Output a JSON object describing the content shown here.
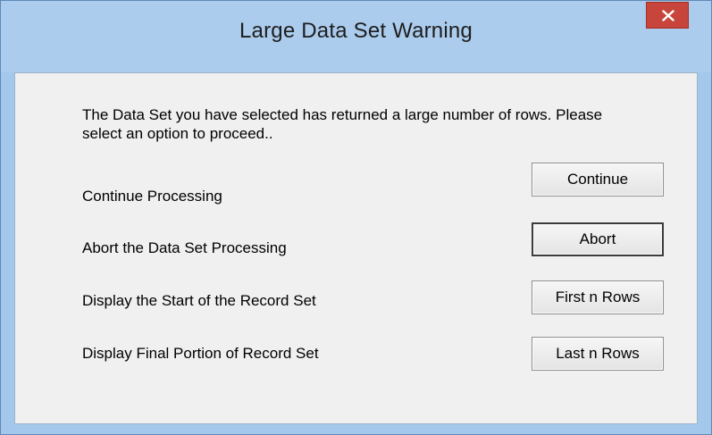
{
  "window": {
    "title": "Large Data Set Warning",
    "close_icon": "close-icon"
  },
  "dialog": {
    "message": "The Data Set you have selected has returned a large number of rows. Please select an option to proceed..",
    "options": [
      {
        "label": "Continue Processing",
        "button": "Continue"
      },
      {
        "label": "Abort the Data Set Processing",
        "button": "Abort"
      },
      {
        "label": "Display the Start of the Record Set",
        "button": "First n Rows"
      },
      {
        "label": "Display Final Portion of Record Set",
        "button": "Last n Rows"
      }
    ]
  },
  "colors": {
    "titlebar": "#abcced",
    "close_button": "#c7453b",
    "client_area": "#f0f0f0"
  }
}
